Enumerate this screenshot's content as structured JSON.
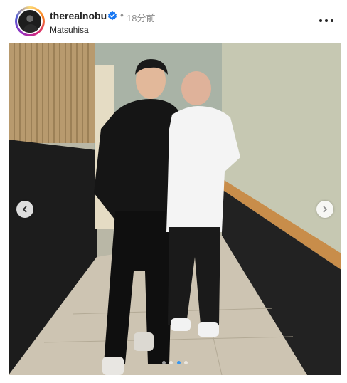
{
  "post": {
    "username": "therealnobu",
    "separator": "•",
    "time": "18分前",
    "location": "Matsuhisa",
    "verified": true
  },
  "carousel": {
    "slide_count": 4,
    "active_index": 2,
    "accent_color": "#3897f0"
  },
  "icons": {
    "verified": "verified-badge-icon",
    "more": "more-options-icon",
    "prev": "chevron-left-icon",
    "next": "chevron-right-icon"
  }
}
